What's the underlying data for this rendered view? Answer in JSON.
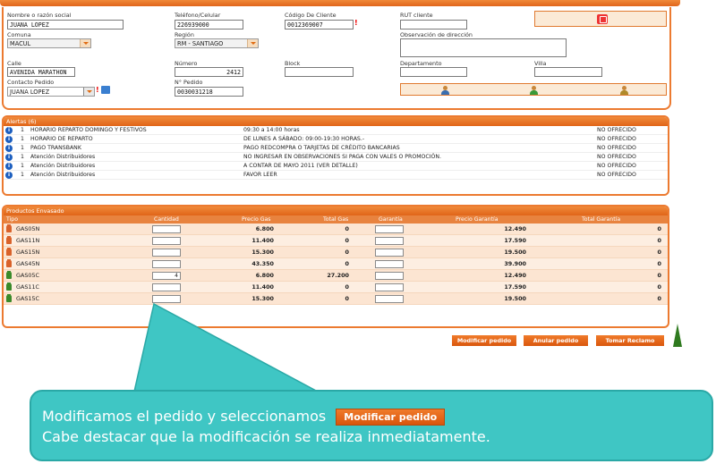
{
  "form": {
    "nombre_label": "Nombre o razón social",
    "nombre_value": "JUANA LOPEZ",
    "telefono_label": "Teléfono/Celular",
    "telefono_value": "226939000",
    "codigo_label": "Código De Cliente",
    "codigo_value": "0012369007",
    "rut_label": "RUT cliente",
    "rut_value": "",
    "comuna_label": "Comuna",
    "comuna_value": "MACUL",
    "region_label": "Región",
    "region_value": "RM - SANTIAGO",
    "observacion_label": "Observación de dirección",
    "calle_label": "Calle",
    "calle_value": "AVENIDA MARATHON",
    "numero_label": "Número",
    "numero_value": "2412",
    "block_label": "Block",
    "departamento_label": "Departamento",
    "villa_label": "Villa",
    "contacto_label": "Contacto Pedido",
    "contacto_value": "JUANA LOPEZ",
    "pedido_label": "N° Pedido",
    "pedido_value": "0030031218",
    "required_mark": "!"
  },
  "alerts": {
    "title": "Alertas (6)",
    "info_glyph": "i",
    "rows": [
      {
        "count": "1",
        "name": "HORARIO REPARTO DOMINGO Y FESTIVOS",
        "detail": "09:30 a 14:00 horas",
        "status": "NO OFRECIDO"
      },
      {
        "count": "1",
        "name": "HORARIO DE REPARTO",
        "detail": "DE LUNES A SÁBADO: 09:00-19:30 HORAS.-",
        "status": "NO OFRECIDO"
      },
      {
        "count": "1",
        "name": "PAGO TRANSBANK",
        "detail": "PAGO REDCOMPRA O TARJETAS DE CRÉDITO BANCARIAS",
        "status": "NO OFRECIDO"
      },
      {
        "count": "1",
        "name": "Atención Distribuidores",
        "detail": "NO INGRESAR EN OBSERVACIONES SI PAGA CON VALES O PROMOCIÓN.",
        "status": "NO OFRECIDO"
      },
      {
        "count": "1",
        "name": "Atención Distribuidores",
        "detail": "A CONTAR DE MAYO 2011 (VER DETALLE)",
        "status": "NO OFRECIDO"
      },
      {
        "count": "1",
        "name": "Atención Distribuidores",
        "detail": "FAVOR LEER",
        "status": "NO OFRECIDO"
      }
    ]
  },
  "products": {
    "title": "Productos Envasado",
    "headers": {
      "tipo": "Tipo",
      "cantidad": "Cantidad",
      "precio_gas": "Precio Gas",
      "total_gas": "Total Gas",
      "garantia": "Garantía",
      "precio_garantia": "Precio Garantía",
      "total_garantia": "Total Garantía"
    },
    "rows": [
      {
        "tipo": "GAS05N",
        "cantidad": "",
        "precio_gas": "6.800",
        "total_gas": "0",
        "precio_garantia": "12.490",
        "total_garantia": "0",
        "icon_color": "#d9622b"
      },
      {
        "tipo": "GAS11N",
        "cantidad": "",
        "precio_gas": "11.400",
        "total_gas": "0",
        "precio_garantia": "17.590",
        "total_garantia": "0",
        "icon_color": "#d9622b"
      },
      {
        "tipo": "GAS15N",
        "cantidad": "",
        "precio_gas": "15.300",
        "total_gas": "0",
        "precio_garantia": "19.500",
        "total_garantia": "0",
        "icon_color": "#d9622b"
      },
      {
        "tipo": "GAS45N",
        "cantidad": "",
        "precio_gas": "43.350",
        "total_gas": "0",
        "precio_garantia": "39.900",
        "total_garantia": "0",
        "icon_color": "#d9622b"
      },
      {
        "tipo": "GAS05C",
        "cantidad": "4",
        "precio_gas": "6.800",
        "total_gas": "27.200",
        "precio_garantia": "12.490",
        "total_garantia": "0",
        "icon_color": "#3a8a2a"
      },
      {
        "tipo": "GAS11C",
        "cantidad": "",
        "precio_gas": "11.400",
        "total_gas": "0",
        "precio_garantia": "17.590",
        "total_garantia": "0",
        "icon_color": "#3a8a2a"
      },
      {
        "tipo": "GAS15C",
        "cantidad": "",
        "precio_gas": "15.300",
        "total_gas": "0",
        "precio_garantia": "19.500",
        "total_garantia": "0",
        "icon_color": "#3a8a2a"
      }
    ]
  },
  "actions": {
    "modificar": "Modificar pedido",
    "anular": "Anular pedido",
    "reclamo": "Tomar Reclamo"
  },
  "callout": {
    "line1": "Modificamos  el pedido y seleccionamos",
    "button_label": "Modificar pedido",
    "line2": "Cabe destacar que la modificación se realiza inmediatamente."
  },
  "colors": {
    "accent": "#ec7a30",
    "callout": "#3fc6c4"
  }
}
